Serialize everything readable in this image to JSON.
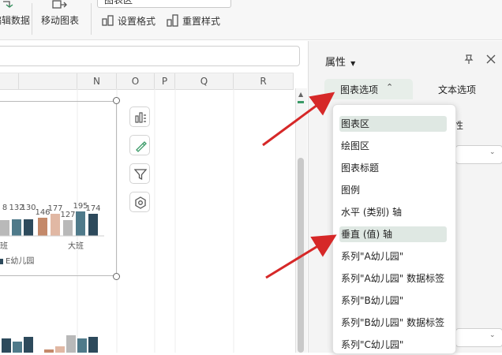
{
  "ribbon": {
    "partial_label": "编辑数据",
    "move_chart": "移动图表",
    "set_format": "设置格式",
    "reset_style": "重置样式",
    "element_select_value": "图表区"
  },
  "sheet": {
    "columns": [
      "N",
      "O",
      "P",
      "Q",
      "R"
    ]
  },
  "chart": {
    "data_labels_left": [
      "8",
      "132",
      "130"
    ],
    "data_labels_right": [
      "146",
      "177",
      "127",
      "195",
      "174"
    ],
    "category_right": "大班",
    "category_left_partial": "班",
    "legend_partial": "E幼儿园",
    "colors": [
      "#c4896a",
      "#e1b8a4",
      "#b9b9b9",
      "#4f7a8a",
      "#2d4a5c"
    ],
    "tool_icons": [
      "chart-elements-icon",
      "chart-style-icon",
      "chart-filter-icon",
      "chart-settings-icon"
    ]
  },
  "panel": {
    "title": "属性",
    "tabs": [
      "图表选项",
      "文本选项"
    ],
    "dropdown_items": [
      "图表区",
      "绘图区",
      "图表标题",
      "图例",
      "水平 (类别) 轴",
      "垂直 (值) 轴",
      "系列\"A幼儿园\"",
      "系列\"A幼儿园\" 数据标签",
      "系列\"B幼儿园\"",
      "系列\"B幼儿园\" 数据标签",
      "系列\"C幼儿园\""
    ],
    "selected_index": 0,
    "highlighted_index": 5,
    "partial_text": "性"
  }
}
